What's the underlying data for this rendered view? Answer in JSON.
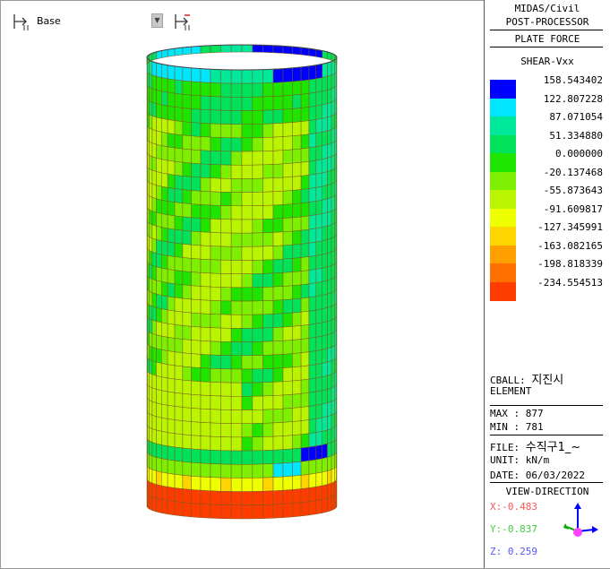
{
  "toolbar": {
    "view_label": "Base"
  },
  "panel": {
    "header_line1": "MIDAS/Civil",
    "header_line2": "POST-PROCESSOR",
    "result_type": "PLATE FORCE",
    "component": "SHEAR-Vxx",
    "legend": [
      {
        "value": "158.543402",
        "color": "#0000ff"
      },
      {
        "value": "122.807228",
        "color": "#00e6ff"
      },
      {
        "value": "87.071054",
        "color": "#00e89a"
      },
      {
        "value": "51.334880",
        "color": "#00e25a"
      },
      {
        "value": "0.000000",
        "color": "#1fe400"
      },
      {
        "value": "-20.137468",
        "color": "#7cf000"
      },
      {
        "value": "-55.873643",
        "color": "#b9f500"
      },
      {
        "value": "-91.609817",
        "color": "#eeff00"
      },
      {
        "value": "-127.345991",
        "color": "#ffd500"
      },
      {
        "value": "-163.082165",
        "color": "#ffa000"
      },
      {
        "value": "-198.818339",
        "color": "#ff7000"
      },
      {
        "value": "-234.554513",
        "color": "#ff3c00"
      }
    ],
    "cball_prefix": "CBALL:",
    "cball_name": "지진시",
    "element_label": "ELEMENT",
    "max_text": "MAX : 877",
    "min_text": "MIN : 781",
    "file_prefix": "FILE:",
    "file_name": "수직구1_~",
    "unit_text": "UNIT: kN/m",
    "date_text": "DATE: 06/03/2022",
    "view_direction_title": "VIEW-DIRECTION",
    "x_dir": "X:-0.483",
    "y_dir": "Y:-0.837",
    "z_dir": "Z: 0.259",
    "x_color": "#ff5555",
    "y_color": "#44cc44",
    "z_color": "#5555ff"
  }
}
